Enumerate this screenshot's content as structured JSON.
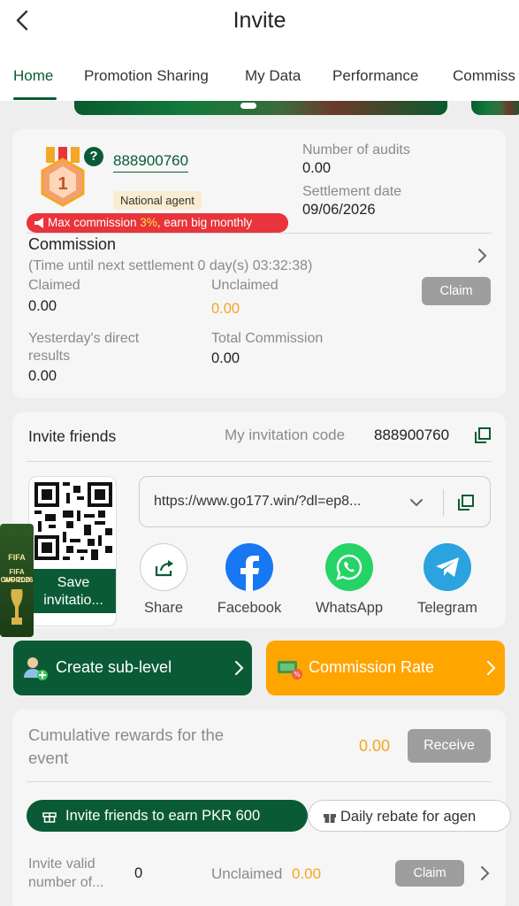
{
  "header": {
    "title": "Invite"
  },
  "tabs": [
    "Home",
    "Promotion Sharing",
    "My Data",
    "Performance",
    "Commiss"
  ],
  "agent": {
    "id": "888900760",
    "level": "1",
    "tag": "National agent",
    "promo_prefix": "Max commission ",
    "promo_highlight": "3%",
    "promo_suffix": ", earn big monthly"
  },
  "audits": {
    "label": "Number of audits",
    "value": "0.00"
  },
  "settlement": {
    "label": "Settlement date",
    "value": "09/06/2026"
  },
  "commission": {
    "title": "Commission",
    "timer": "(Time until next settlement  0 day(s) 03:32:38)",
    "claimed_label": "Claimed",
    "claimed_value": "0.00",
    "unclaimed_label": "Unclaimed",
    "unclaimed_value": "0.00",
    "claim_button": "Claim",
    "yesterday_label_1": "Yesterday's direct",
    "yesterday_label_2": "results",
    "yesterday_value": "0.00",
    "total_label": "Total Commission",
    "total_value": "0.00"
  },
  "invite": {
    "title": "Invite friends",
    "code_label": "My invitation code",
    "code_value": "888900760",
    "save_label_1": "Save",
    "save_label_2": "invitatio...",
    "url": "https://www.go177.win/?dl=ep8...",
    "share": [
      {
        "label": "Share",
        "icon": "share-icon"
      },
      {
        "label": "Facebook",
        "icon": "facebook-icon"
      },
      {
        "label": "WhatsApp",
        "icon": "whatsapp-icon"
      },
      {
        "label": "Telegram",
        "icon": "telegram-icon"
      }
    ]
  },
  "actions": {
    "create": "Create sub-level",
    "rate": "Commission Rate"
  },
  "rewards": {
    "title_1": "Cumulative rewards for the",
    "title_2": "event",
    "value": "0.00",
    "receive_button": "Receive",
    "pill_1": "Invite friends to earn PKR 600",
    "pill_2": "Daily rebate for agen",
    "valid_label_1": "Invite valid",
    "valid_label_2": "number of...",
    "valid_value": "0",
    "unclaimed_label": "Unclaimed",
    "unclaimed_value": "0.00",
    "claim_button": "Claim"
  },
  "colors": {
    "brand_green": "#0a5b35",
    "orange": "#ffa500",
    "accent_amount": "#f5a623",
    "promo_red": "#e8343a"
  },
  "fifa_badge": {
    "line1": "FIFA",
    "line2": "FIFA WORLD",
    "line3": "CUP 2026"
  }
}
